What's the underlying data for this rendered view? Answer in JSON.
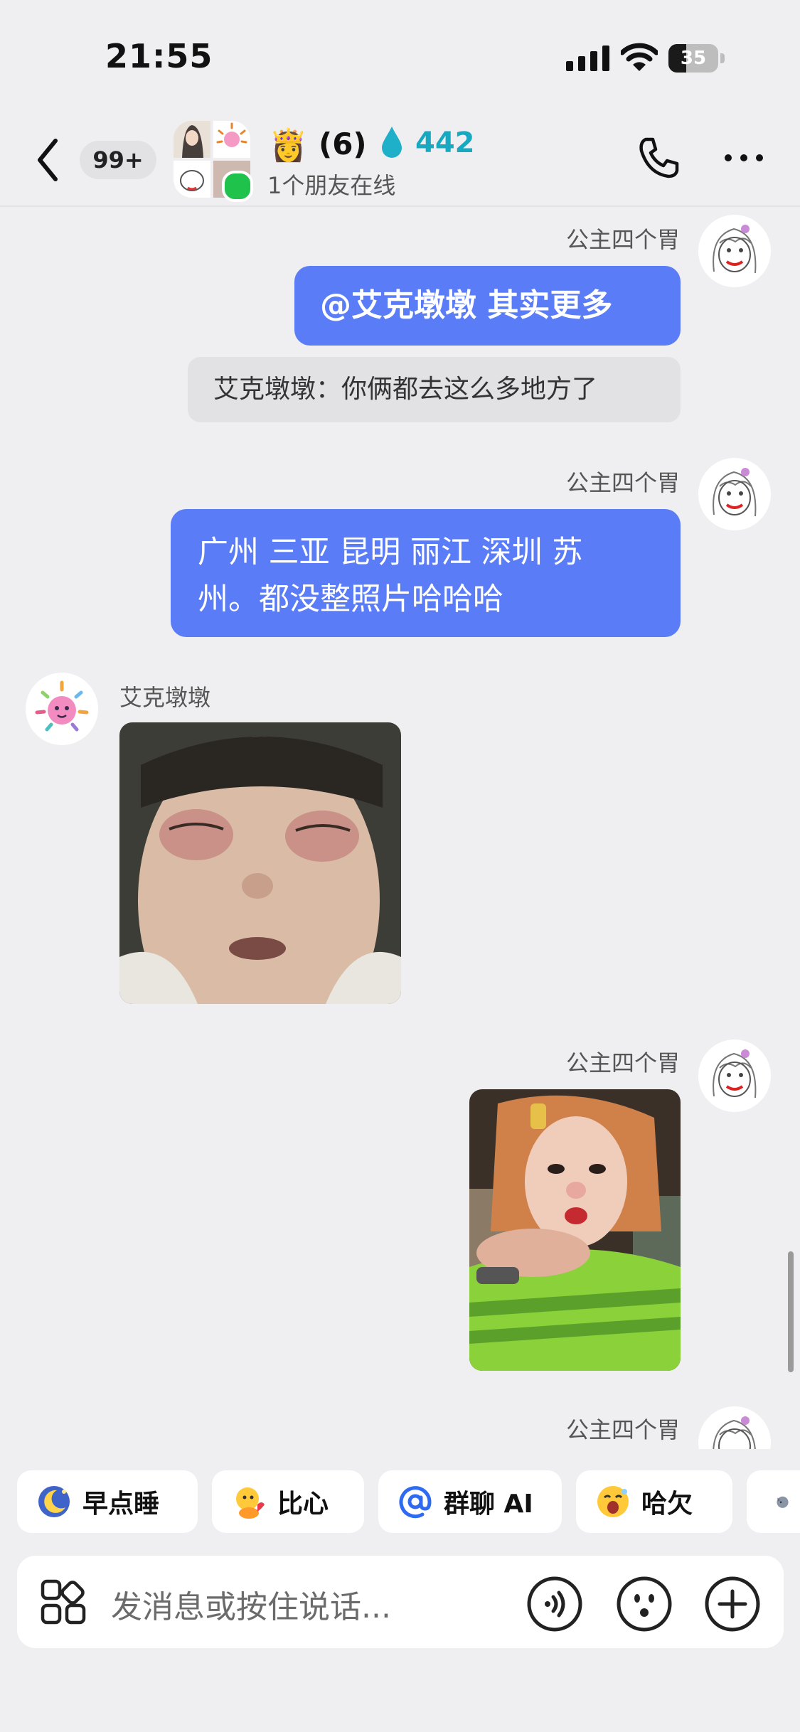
{
  "status_bar": {
    "time": "21:55",
    "battery": "35",
    "battery_level": 0.35
  },
  "header": {
    "back_label": "back",
    "unread_badge": "99+",
    "group_emoji": "👸",
    "member_count": "(6)",
    "score": "442",
    "subtitle": "1个朋友在线",
    "icons": [
      "chevron-left-icon",
      "water-drop-icon",
      "phone-icon",
      "more-icon"
    ]
  },
  "messages": [
    {
      "side": "right",
      "sender": "公主四个胃",
      "type": "text",
      "text": "@艾克墩墩 其实更多",
      "quote": "艾克墩墩：你俩都去这么多地方了"
    },
    {
      "side": "right",
      "sender": "公主四个胃",
      "type": "text",
      "lines": [
        "广州 三亚  昆明 丽江 深圳  苏",
        "州。都没整照片哈哈哈"
      ]
    },
    {
      "side": "left",
      "sender": "艾克墩墩",
      "type": "image",
      "desc": "child-face-photo"
    },
    {
      "side": "right",
      "sender": "公主四个胃",
      "type": "image",
      "desc": "selfie-photo"
    },
    {
      "side": "right",
      "sender": "公主四个胃",
      "type": "pending"
    }
  ],
  "quick_replies": [
    {
      "label": "早点睡",
      "icon": "moon-icon"
    },
    {
      "label": "比心",
      "icon": "heart-hand-icon"
    },
    {
      "label": "群聊 AI",
      "icon": "at-icon"
    },
    {
      "label": "哈欠",
      "icon": "yawn-icon"
    }
  ],
  "input": {
    "placeholder": "发消息或按住说话...",
    "icons": [
      "apps-grid-icon",
      "voice-icon",
      "emoji-icon",
      "plus-icon"
    ]
  },
  "colors": {
    "bubble": "#5a7cf6",
    "background": "#efeff1",
    "score": "#17a9c2",
    "online": "#1fc24b"
  }
}
